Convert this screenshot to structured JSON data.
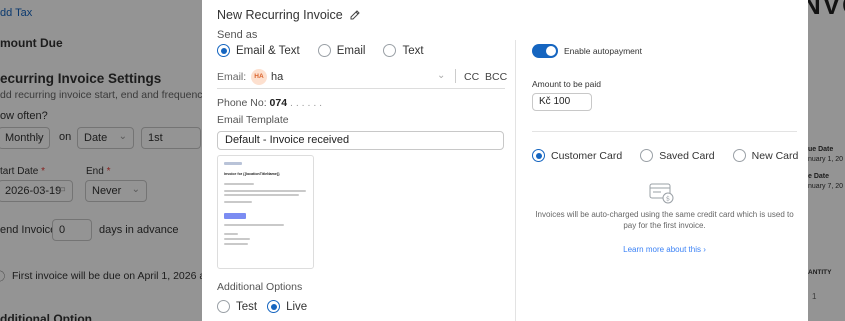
{
  "background": {
    "left": {
      "add_tax": "dd Tax",
      "amount_due": "mount Due",
      "section_title": "ecurring Invoice Settings",
      "section_desc": "dd recurring invoice start, end and frequency co",
      "how_often": "ow often?",
      "frequency": "Monthly",
      "on": "on",
      "on_type": "Date",
      "day": "1st",
      "start_date_label": "tart Date",
      "start_date": "2026-03-19",
      "end_label": "End",
      "end_value": "Never",
      "send_invoice": "end Invoice",
      "days_value": "0",
      "days_suffix": "days in advance",
      "first_invoice_note": "First invoice will be due on April 1, 2026 and s",
      "additional_options": "dditional Option"
    },
    "right": {
      "header": "NVC",
      "issue_date_label": "ue Date",
      "issue_date": "nuary 1, 20",
      "due_date_label": "e Date",
      "due_date": "nuary 7, 20",
      "quantity_header": "ANTITY",
      "quantity_value": "1"
    }
  },
  "modal": {
    "title": "New Recurring Invoice",
    "send_as_label": "Send as",
    "send_as_options": [
      "Email & Text",
      "Email",
      "Text"
    ],
    "send_as_selected": "Email & Text",
    "email_label": "Email:",
    "email_avatar": "HA",
    "email_value": "ha",
    "cc_label": "CC",
    "bcc_label": "BCC",
    "phone_label": "Phone No:",
    "phone_value": "074",
    "email_template_label": "Email Template",
    "email_template_value": "Default - Invoice received",
    "preview": {
      "title": "Invoice for {{locationTitleName}}"
    },
    "additional_options_label": "Additional Options",
    "mode_options": [
      "Test",
      "Live"
    ],
    "mode_selected": "Live",
    "autopay_label": "Enable autopayment",
    "autopay_enabled": true,
    "amount_label": "Amount to be paid",
    "amount_value": "Kč 100",
    "card_options": [
      "Customer Card",
      "Saved Card",
      "New Card"
    ],
    "card_selected": "Customer Card",
    "info_text": "Invoices will be auto-charged using the same credit card which is used to pay for the first invoice.",
    "learn_more": "Learn more about this ›",
    "accent_color": "#1565c0",
    "link_color": "#3b82f6"
  }
}
